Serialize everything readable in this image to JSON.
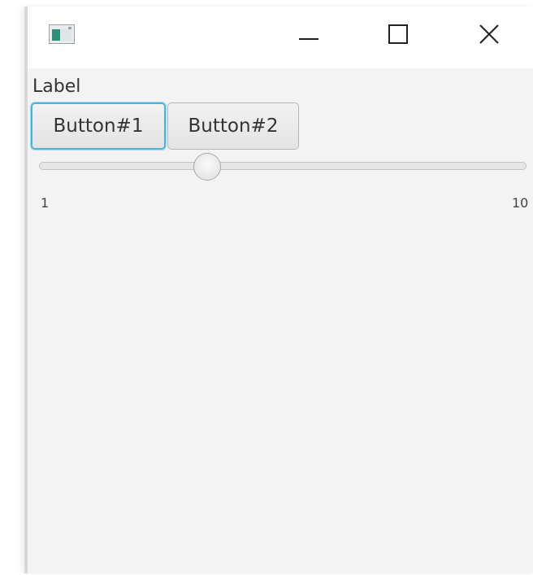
{
  "window": {
    "icon": "app-window-icon",
    "controls": {
      "minimize": "minimize-icon",
      "maximize": "maximize-icon",
      "close": "close-icon"
    }
  },
  "content": {
    "label": "Label",
    "buttons": [
      {
        "label": "Button#1",
        "focused": true
      },
      {
        "label": "Button#2",
        "focused": false
      }
    ],
    "slider": {
      "min": "1",
      "max": "10",
      "value_fraction": 0.345
    }
  },
  "colors": {
    "window_background": "#f3f3f3",
    "titlebar_background": "#ffffff",
    "focus_ring": "#4ab3e0",
    "text": "#333333"
  }
}
